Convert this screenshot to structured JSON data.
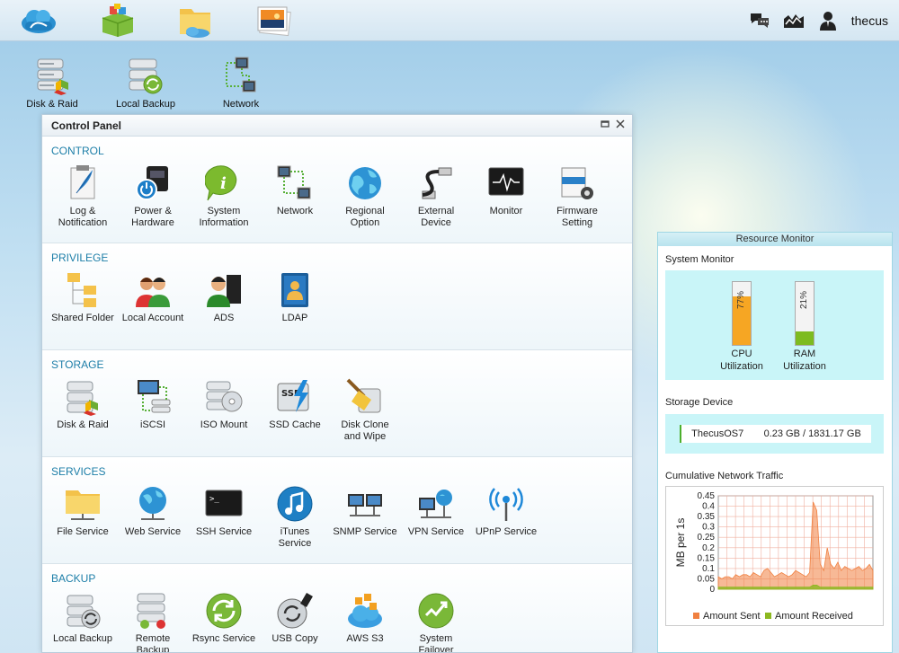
{
  "topbar": {
    "username": "thecus",
    "apps": [
      {
        "icon": "cloud-logo-icon"
      },
      {
        "icon": "app-center-icon"
      },
      {
        "icon": "file-manager-icon"
      },
      {
        "icon": "photo-gallery-icon"
      }
    ],
    "right_icons": [
      "chat-icon",
      "monitor-icon",
      "user-icon"
    ]
  },
  "desktop": {
    "shortcuts": [
      {
        "label": "Disk & Raid",
        "icon": "disk-raid-icon"
      },
      {
        "label": "Local Backup",
        "icon": "local-backup-icon"
      },
      {
        "label": "Network",
        "icon": "network-icon"
      }
    ]
  },
  "control_panel": {
    "title": "Control Panel",
    "sections": [
      {
        "title": "CONTROL",
        "items": [
          {
            "label": "Log &\nNotification",
            "icon": "log-notification-icon"
          },
          {
            "label": "Power &\nHardware",
            "icon": "power-hardware-icon"
          },
          {
            "label": "System\nInformation",
            "icon": "system-information-icon"
          },
          {
            "label": "Network",
            "icon": "network-icon"
          },
          {
            "label": "Regional\nOption",
            "icon": "globe-icon"
          },
          {
            "label": "External\nDevice",
            "icon": "usb-cable-icon"
          },
          {
            "label": "Monitor",
            "icon": "monitor-icon"
          },
          {
            "label": "Firmware\nSetting",
            "icon": "firmware-icon"
          }
        ]
      },
      {
        "title": "PRIVILEGE",
        "items": [
          {
            "label": "Shared Folder",
            "icon": "shared-folder-icon"
          },
          {
            "label": "Local Account",
            "icon": "local-account-icon"
          },
          {
            "label": "ADS",
            "icon": "ads-icon"
          },
          {
            "label": "LDAP",
            "icon": "ldap-icon"
          }
        ]
      },
      {
        "title": "STORAGE",
        "items": [
          {
            "label": "Disk & Raid",
            "icon": "disk-raid-icon"
          },
          {
            "label": "iSCSI",
            "icon": "iscsi-icon"
          },
          {
            "label": "ISO Mount",
            "icon": "iso-mount-icon"
          },
          {
            "label": "SSD Cache",
            "icon": "ssd-cache-icon"
          },
          {
            "label": "Disk Clone\nand Wipe",
            "icon": "disk-clone-icon"
          }
        ]
      },
      {
        "title": "SERVICES",
        "items": [
          {
            "label": "File Service",
            "icon": "file-service-icon"
          },
          {
            "label": "Web Service",
            "icon": "web-service-icon"
          },
          {
            "label": "SSH Service",
            "icon": "ssh-terminal-icon"
          },
          {
            "label": "iTunes\nService",
            "icon": "itunes-icon"
          },
          {
            "label": "SNMP Service",
            "icon": "snmp-icon"
          },
          {
            "label": "VPN Service",
            "icon": "vpn-icon"
          },
          {
            "label": "UPnP Service",
            "icon": "upnp-icon"
          }
        ]
      },
      {
        "title": "BACKUP",
        "items": [
          {
            "label": "Local Backup",
            "icon": "local-backup-icon"
          },
          {
            "label": "Remote\nBackup",
            "icon": "remote-backup-icon"
          },
          {
            "label": "Rsync Service",
            "icon": "rsync-icon"
          },
          {
            "label": "USB Copy",
            "icon": "usb-copy-icon"
          },
          {
            "label": "AWS S3",
            "icon": "aws-s3-icon"
          },
          {
            "label": "System\nFailover",
            "icon": "system-failover-icon"
          }
        ]
      }
    ]
  },
  "resource_monitor": {
    "title": "Resource Monitor",
    "system_monitor_label": "System Monitor",
    "cpu": {
      "pct_label": "77%",
      "value": 77,
      "label": "CPU\nUtilization",
      "color": "#f6a623"
    },
    "ram": {
      "pct_label": "21%",
      "value": 21,
      "label": "RAM\nUtilization",
      "color": "#7dbb1f"
    },
    "storage_label": "Storage Device",
    "storage": {
      "name": "ThecusOS7",
      "usage": "0.23 GB / 1831.17 GB"
    },
    "network_label": "Cumulative Network Traffic"
  },
  "chart_data": {
    "type": "area",
    "ylabel": "MB per 1s",
    "ylim": [
      0,
      0.45
    ],
    "yticks": [
      "0.45",
      "0.4",
      "0.35",
      "0.3",
      "0.25",
      "0.2",
      "0.15",
      "0.1",
      "0.05",
      "0"
    ],
    "grid": true,
    "legend_position": "bottom",
    "series": [
      {
        "name": "Amount Sent",
        "color": "#f08040",
        "values": [
          0.06,
          0.05,
          0.06,
          0.06,
          0.05,
          0.07,
          0.06,
          0.07,
          0.07,
          0.06,
          0.08,
          0.07,
          0.06,
          0.09,
          0.1,
          0.08,
          0.06,
          0.07,
          0.08,
          0.07,
          0.06,
          0.07,
          0.09,
          0.08,
          0.07,
          0.06,
          0.08,
          0.42,
          0.38,
          0.12,
          0.09,
          0.2,
          0.12,
          0.1,
          0.13,
          0.09,
          0.11,
          0.1,
          0.09,
          0.1,
          0.11,
          0.09,
          0.1,
          0.12,
          0.09
        ]
      },
      {
        "name": "Amount Received",
        "color": "#8cb820",
        "values": [
          0.01,
          0.01,
          0.01,
          0.01,
          0.01,
          0.01,
          0.01,
          0.01,
          0.01,
          0.01,
          0.01,
          0.01,
          0.01,
          0.01,
          0.01,
          0.01,
          0.01,
          0.01,
          0.01,
          0.01,
          0.01,
          0.01,
          0.01,
          0.01,
          0.01,
          0.01,
          0.01,
          0.02,
          0.02,
          0.01,
          0.01,
          0.01,
          0.01,
          0.01,
          0.01,
          0.01,
          0.01,
          0.01,
          0.01,
          0.01,
          0.01,
          0.01,
          0.01,
          0.01,
          0.01
        ]
      }
    ]
  }
}
